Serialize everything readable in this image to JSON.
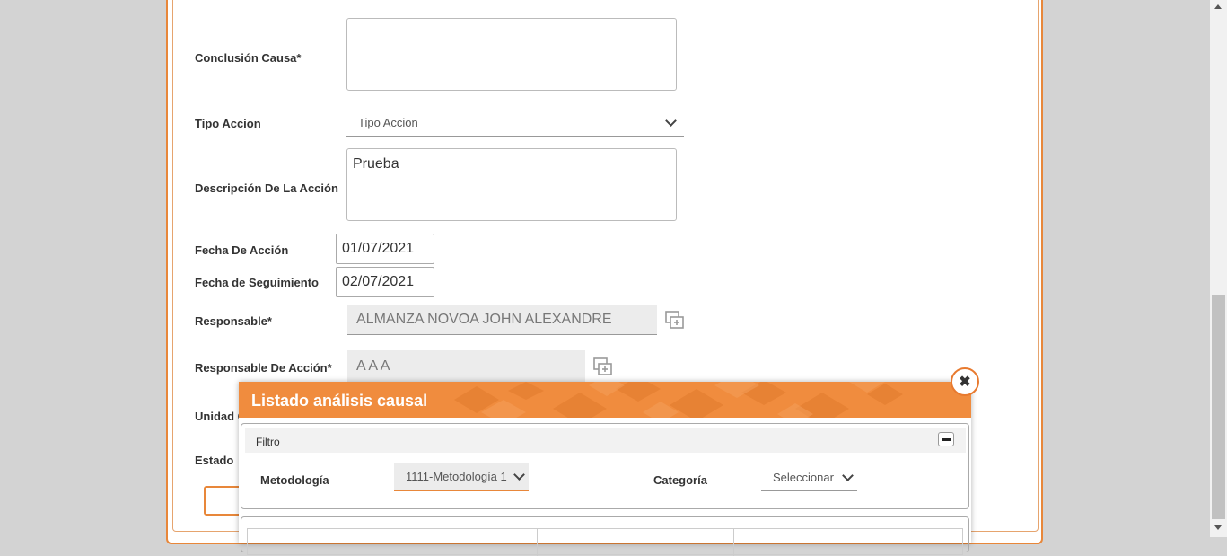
{
  "form": {
    "conclusion_label": "Conclusión Causa*",
    "tipo_accion_label": "Tipo Accion",
    "tipo_accion_value": "Tipo Accion",
    "descripcion_label": "Descripción De La Acción",
    "descripcion_value": "Prueba",
    "fecha_accion_label": "Fecha De Acción",
    "fecha_accion_value": "01/07/2021",
    "fecha_seguimiento_label": "Fecha de Seguimiento",
    "fecha_seguimiento_value": "02/07/2021",
    "responsable_label": "Responsable*",
    "responsable_value": "ALMANZA NOVOA JOHN ALEXANDRE",
    "responsable_accion_label": "Responsable De Acción*",
    "responsable_accion_value": "A A A",
    "unidad_label": "Unidad C",
    "estado_label": "Estado"
  },
  "modal": {
    "title": "Listado análisis causal",
    "filter_title": "Filtro",
    "metodologia_label": "Metodología",
    "metodologia_value": "1111-Metodología 1",
    "categoria_label": "Categoría",
    "categoria_value": "Seleccionar"
  },
  "colors": {
    "accent": "#f08c3e",
    "border_orange": "#e8873a"
  }
}
